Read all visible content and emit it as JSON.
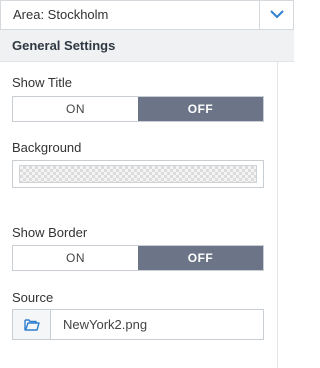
{
  "area_select": {
    "value": "Area: Stockholm",
    "icon": "chevron-down-icon"
  },
  "section": {
    "title": "General Settings"
  },
  "show_title": {
    "label": "Show Title",
    "on_label": "ON",
    "off_label": "OFF",
    "selected": "OFF"
  },
  "background": {
    "label": "Background",
    "value": "transparent"
  },
  "show_border": {
    "label": "Show Border",
    "on_label": "ON",
    "off_label": "OFF",
    "selected": "OFF"
  },
  "source": {
    "label": "Source",
    "file_name": "NewYork2.png",
    "icon": "folder-open-icon"
  },
  "colors": {
    "accent": "#2f7fd0",
    "toggle_selected": "#6b7587",
    "header_bg": "#f0f1f3"
  }
}
